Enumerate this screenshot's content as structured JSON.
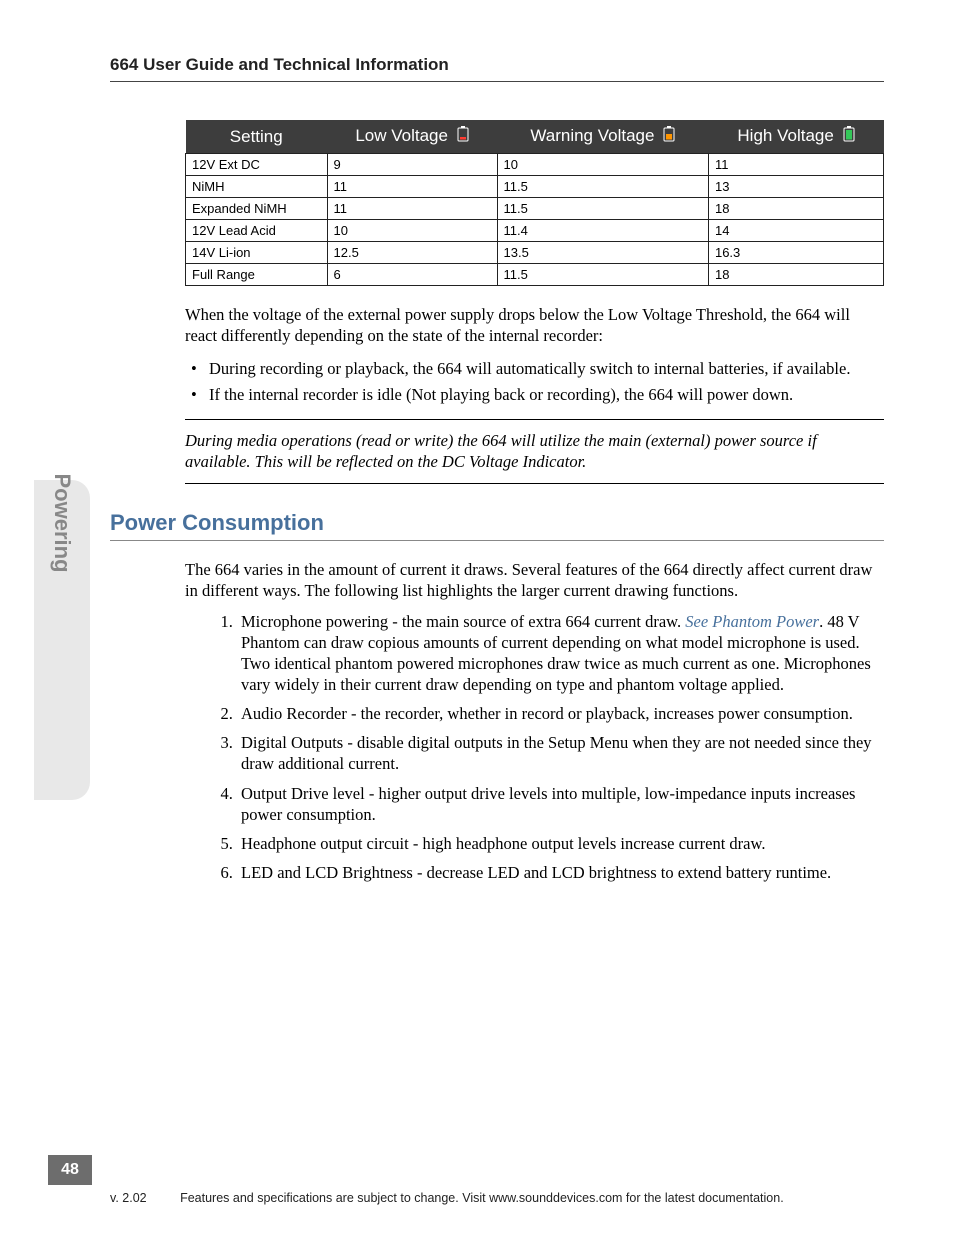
{
  "header": {
    "title": "664 User Guide and Technical Information"
  },
  "chart_data": {
    "type": "table",
    "columns": [
      "Setting",
      "Low Voltage",
      "Warning Voltage",
      "High Voltage"
    ],
    "rows": [
      {
        "setting": "12V Ext DC",
        "low": "9",
        "warn": "10",
        "high": "11"
      },
      {
        "setting": "NiMH",
        "low": "11",
        "warn": "11.5",
        "high": "13"
      },
      {
        "setting": "Expanded NiMH",
        "low": "11",
        "warn": "11.5",
        "high": "18"
      },
      {
        "setting": "12V Lead Acid",
        "low": "10",
        "warn": "11.4",
        "high": "14"
      },
      {
        "setting": "14V Li-ion",
        "low": "12.5",
        "warn": "13.5",
        "high": "16.3"
      },
      {
        "setting": "Full Range",
        "low": "6",
        "warn": "11.5",
        "high": "18"
      }
    ]
  },
  "paragraph1": "When the voltage of the external power supply drops below the Low Voltage Threshold, the 664 will react differently depending on the state of the internal recorder:",
  "bullets": [
    "During recording or playback, the 664 will automatically switch to internal batteries, if available.",
    "If the internal recorder is idle (Not playing back or recording), the 664 will power down."
  ],
  "note": "During media operations (read or write) the 664 will utilize the main (external) power source if available. This will be reflected on the DC Voltage Indicator.",
  "section": {
    "heading": "Power Consumption",
    "intro": "The 664 varies in the amount of current it draws. Several features of the 664 directly affect current draw in different ways. The following list highlights the larger current drawing functions.",
    "items": [
      {
        "pre": "Microphone powering - the main source of extra 664 current draw. ",
        "link": "See Phantom Power",
        "post": ". 48 V Phantom can draw copious amounts of current depending on what model microphone is used. Two identical phantom powered microphones draw twice as much current as one. Microphones vary widely in their current draw depending on type and phantom voltage applied."
      },
      {
        "pre": "Audio Recorder - the recorder, whether in record or playback, increases power consumption.",
        "link": "",
        "post": ""
      },
      {
        "pre": "Digital Outputs - disable digital outputs in the Setup Menu when they are not needed since they draw additional current.",
        "link": "",
        "post": ""
      },
      {
        "pre": "Output Drive level - higher output drive levels into multiple, low-impedance inputs increases power consumption.",
        "link": "",
        "post": ""
      },
      {
        "pre": "Headphone output circuit - high headphone output levels increase current draw.",
        "link": "",
        "post": ""
      },
      {
        "pre": "LED and LCD Brightness - decrease LED and LCD brightness to extend battery runtime.",
        "link": "",
        "post": ""
      }
    ]
  },
  "sideTab": "Powering",
  "pageNumber": "48",
  "footer": {
    "version": "v. 2.02",
    "text": "Features and specifications are subject to change. Visit www.sounddevices.com for the latest documentation."
  },
  "icons": {
    "low": "#ff3b30",
    "warn": "#ff9500",
    "high": "#34c759"
  }
}
